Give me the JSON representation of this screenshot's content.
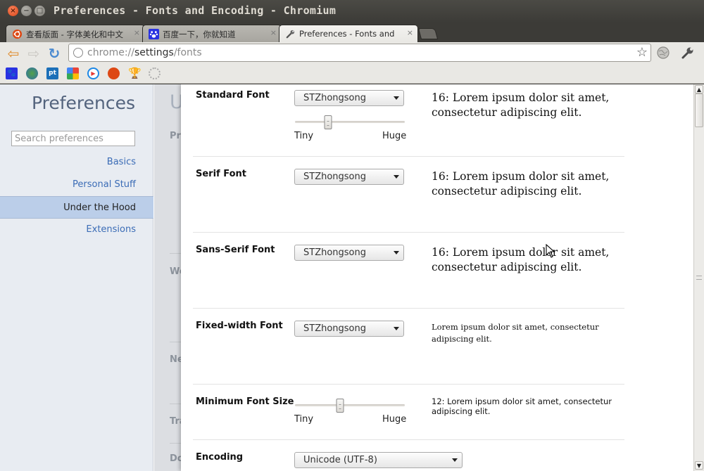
{
  "window": {
    "title": "Preferences - Fonts and Encoding - Chromium",
    "close_glyph": "×",
    "min_glyph": "−",
    "max_glyph": "□"
  },
  "tabs": [
    {
      "label": "查看版面 - 字体美化和中文",
      "close": "×"
    },
    {
      "label": "百度一下，你就知道",
      "close": "×"
    },
    {
      "label": "Preferences - Fonts and",
      "close": "×"
    }
  ],
  "address": {
    "scheme": "chrome://",
    "host": "settings",
    "path": "/fonts"
  },
  "toolbar": {
    "back": "⇦",
    "forward": "⇨",
    "reload": "↻",
    "star": "☆",
    "wrench": "🔧"
  },
  "colors": {
    "accent_link": "#3b6cb6",
    "selected_nav": "#bbcee9"
  },
  "sidebar": {
    "title": "Preferences",
    "search_placeholder": "Search preferences",
    "items": [
      {
        "label": "Basics"
      },
      {
        "label": "Personal Stuff"
      },
      {
        "label": "Under the Hood"
      },
      {
        "label": "Extensions"
      }
    ]
  },
  "background_page": {
    "title_fragment": "U",
    "section_fragments": [
      "Pri",
      "We",
      "Ne",
      "Tra",
      "Do"
    ]
  },
  "fonts": {
    "standard": {
      "label": "Standard Font",
      "value": "STZhongsong",
      "sample": "16: Lorem ipsum dolor sit amet, consectetur adipiscing elit.",
      "slider_min": "Tiny",
      "slider_max": "Huge",
      "slider_position": 0.3
    },
    "serif": {
      "label": "Serif Font",
      "value": "STZhongsong",
      "sample": "16: Lorem ipsum dolor sit amet, consectetur adipiscing elit."
    },
    "sans_serif": {
      "label": "Sans-Serif Font",
      "value": "STZhongsong",
      "sample": "16: Lorem ipsum dolor sit amet, consectetur adipiscing elit."
    },
    "fixed_width": {
      "label": "Fixed-width Font",
      "value": "STZhongsong",
      "sample": "Lorem ipsum dolor sit amet, consectetur adipiscing elit."
    },
    "minimum": {
      "label": "Minimum Font Size",
      "sample": "12: Lorem ipsum dolor sit amet, consectetur adipiscing elit.",
      "slider_min": "Tiny",
      "slider_max": "Huge",
      "slider_position": 0.41
    },
    "encoding": {
      "label": "Encoding",
      "value": "Unicode (UTF-8)"
    }
  }
}
